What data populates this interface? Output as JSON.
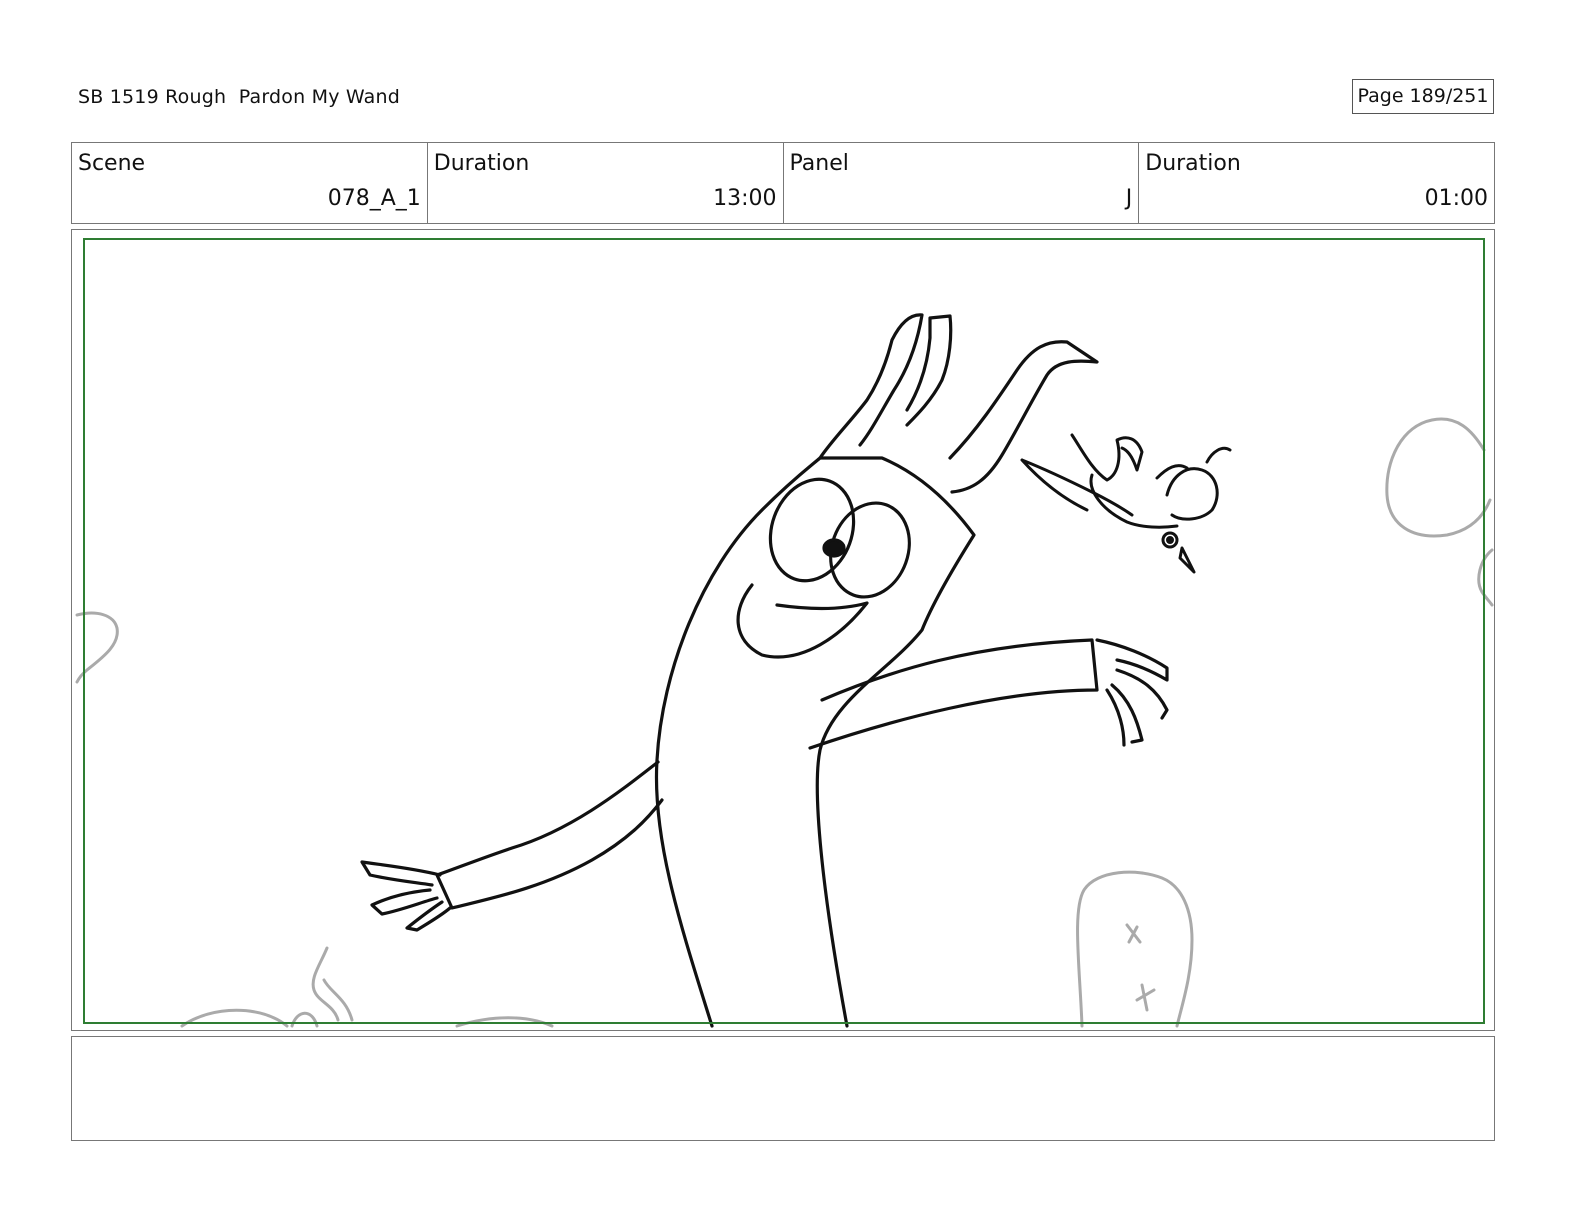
{
  "header": {
    "title": "SB 1519 Rough  Pardon My Wand",
    "page": "Page 189/251"
  },
  "meta": {
    "scene_label": "Scene",
    "scene_value": "078_A_1",
    "scene_duration_label": "Duration",
    "scene_duration_value": "13:00",
    "panel_label": "Panel",
    "panel_value": "J",
    "panel_duration_label": "Duration",
    "panel_duration_value": "01:00"
  },
  "notes": {
    "text": ""
  },
  "colors": {
    "safe_frame": "#2e7d32",
    "sketch_line": "#111111",
    "background_sketch": "#aaaaaa"
  }
}
